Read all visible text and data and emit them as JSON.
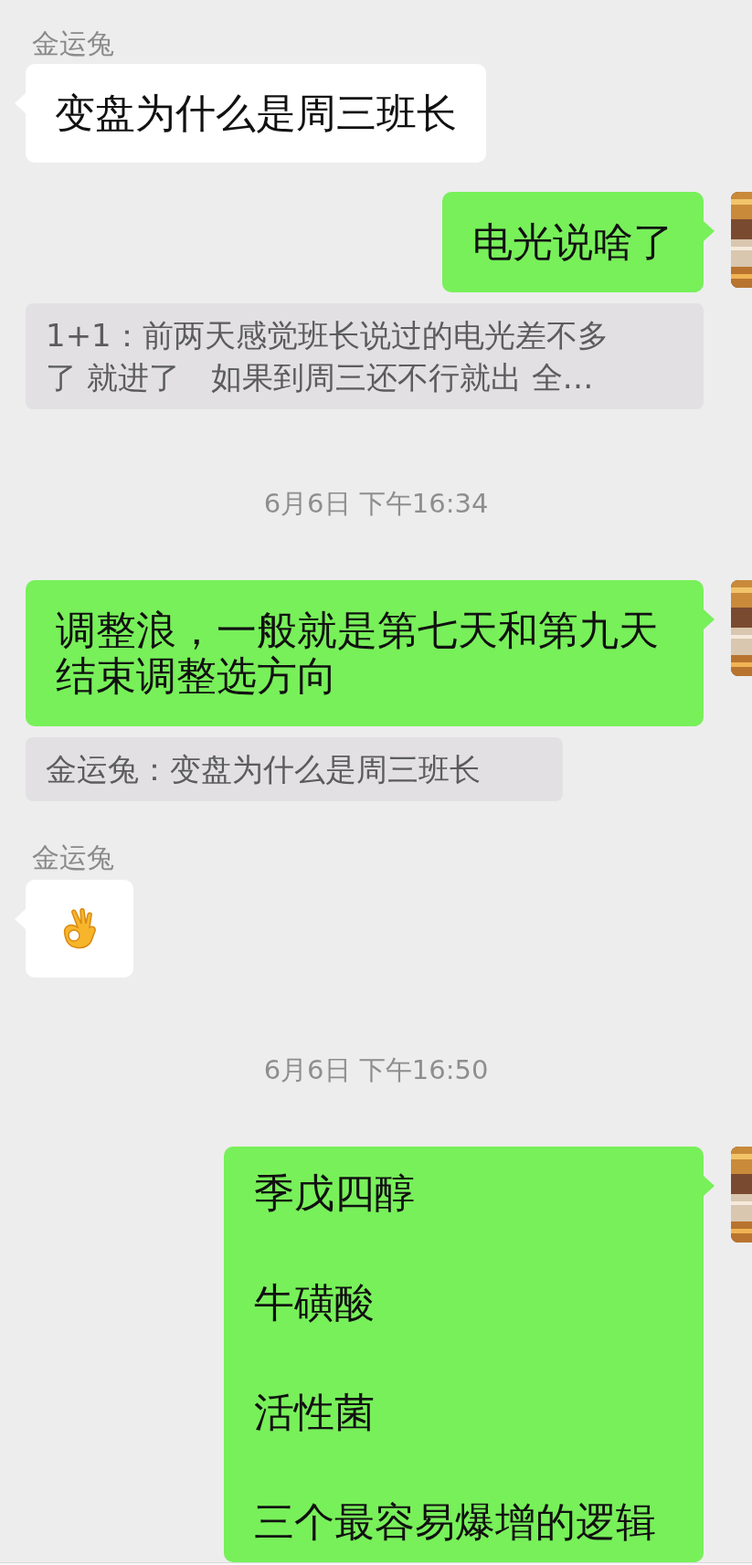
{
  "messages": [
    {
      "kind": "received",
      "sender": "金运兔",
      "text": "变盘为什么是周三班长"
    },
    {
      "kind": "sent",
      "text": "电光说啥了",
      "quote": "1+1：前两天感觉班长说过的电光差不多了 就进了　如果到周三还不行就出  全…"
    },
    {
      "kind": "time",
      "text": "6月6日 下午16:34"
    },
    {
      "kind": "sent",
      "text": "调整浪，一般就是第七天和第九天结束调整选方向",
      "quote": "金运兔：变盘为什么是周三班长"
    },
    {
      "kind": "emoji",
      "sender": "金运兔"
    },
    {
      "kind": "time",
      "text": "6月6日 下午16:50"
    },
    {
      "kind": "sent_lines",
      "lines": [
        "季戊四醇",
        "牛磺酸",
        "活性菌",
        "三个最容易爆增的逻辑"
      ]
    }
  ]
}
